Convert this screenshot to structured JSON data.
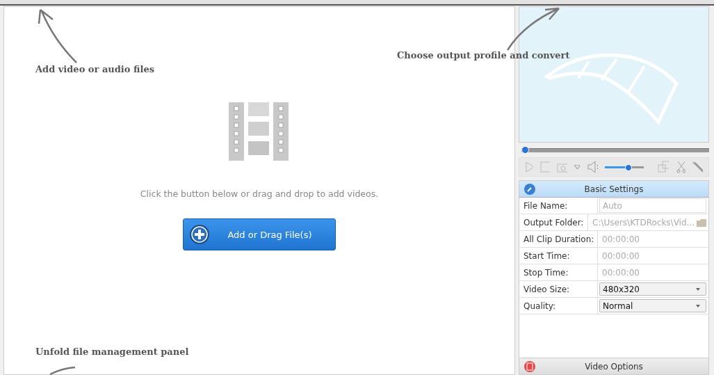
{
  "annotations": [
    {
      "kind": "add",
      "text": "Add video or audio files"
    },
    {
      "kind": "convert",
      "text": "Choose output profile and convert"
    },
    {
      "kind": "unfold",
      "text": "Unfold file management panel"
    }
  ],
  "drop_area": {
    "hint": "Click the button below or drag and drop to add videos.",
    "button": "Add or Drag File(s)"
  },
  "player": {
    "seek": {
      "level": 0
    },
    "volume": {
      "level": 0.6
    }
  },
  "basic_settings": {
    "title": "Basic Settings",
    "rows": [
      {
        "label": "File Name:",
        "kind": "text",
        "value": "Auto"
      },
      {
        "label": "Output Folder:",
        "kind": "folder",
        "value": "C:\\Users\\KTDRocks\\Vid..."
      },
      {
        "label": "All Clip Duration:",
        "kind": "time",
        "value": "00:00:00"
      },
      {
        "label": "Start Time:",
        "kind": "time",
        "value": "00:00:00"
      },
      {
        "label": "Stop Time:",
        "kind": "time",
        "value": "00:00:00"
      },
      {
        "label": "Video Size:",
        "kind": "select",
        "value": "480x320"
      },
      {
        "label": "Quality:",
        "kind": "select",
        "value": "Normal"
      }
    ]
  },
  "video_options": {
    "title": "Video Options"
  }
}
